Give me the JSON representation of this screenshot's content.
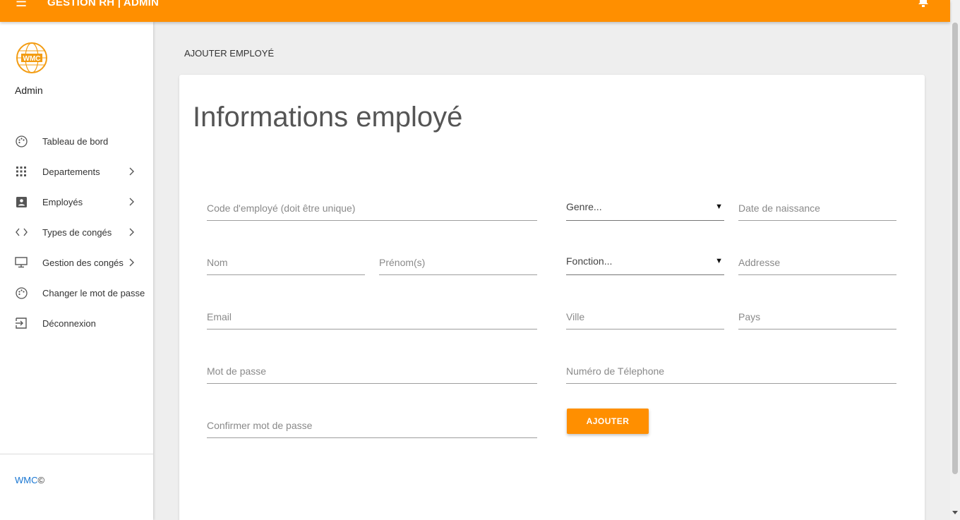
{
  "app": {
    "title": "GESTION RH | ADMIN"
  },
  "colors": {
    "accent": "#ff8f00",
    "link": "#1976d2"
  },
  "sidebar": {
    "logo_text": "WMC",
    "user": "Admin",
    "items": [
      {
        "label": "Tableau de bord",
        "icon": "palette-icon",
        "has_chevron": false
      },
      {
        "label": "Departements",
        "icon": "grid-icon",
        "has_chevron": true
      },
      {
        "label": "Employés",
        "icon": "contact-icon",
        "has_chevron": true
      },
      {
        "label": "Types de congés",
        "icon": "code-icon",
        "has_chevron": true
      },
      {
        "label": "Gestion des congés",
        "icon": "monitor-icon",
        "has_chevron": true
      },
      {
        "label": "Changer le mot de passe",
        "icon": "palette-icon",
        "has_chevron": false
      },
      {
        "label": "Déconnexion",
        "icon": "exit-icon",
        "has_chevron": false
      }
    ],
    "footer": {
      "brand": "WMC",
      "symbol": "©"
    }
  },
  "page": {
    "breadcrumb": "AJOUTER EMPLOYÉ"
  },
  "form": {
    "title": "Informations employé",
    "fields": {
      "code": "Code d'employé (doit être unique)",
      "nom": "Nom",
      "prenom": "Prénom(s)",
      "email": "Email",
      "password": "Mot de passe",
      "confirm_password": "Confirmer mot de passe",
      "date_naissance": "Date de naissance",
      "adresse": "Addresse",
      "ville": "Ville",
      "pays": "Pays",
      "telephone": "Numéro de Télephone"
    },
    "selects": {
      "genre": "Genre...",
      "fonction": "Fonction..."
    },
    "submit_label": "AJOUTER"
  }
}
